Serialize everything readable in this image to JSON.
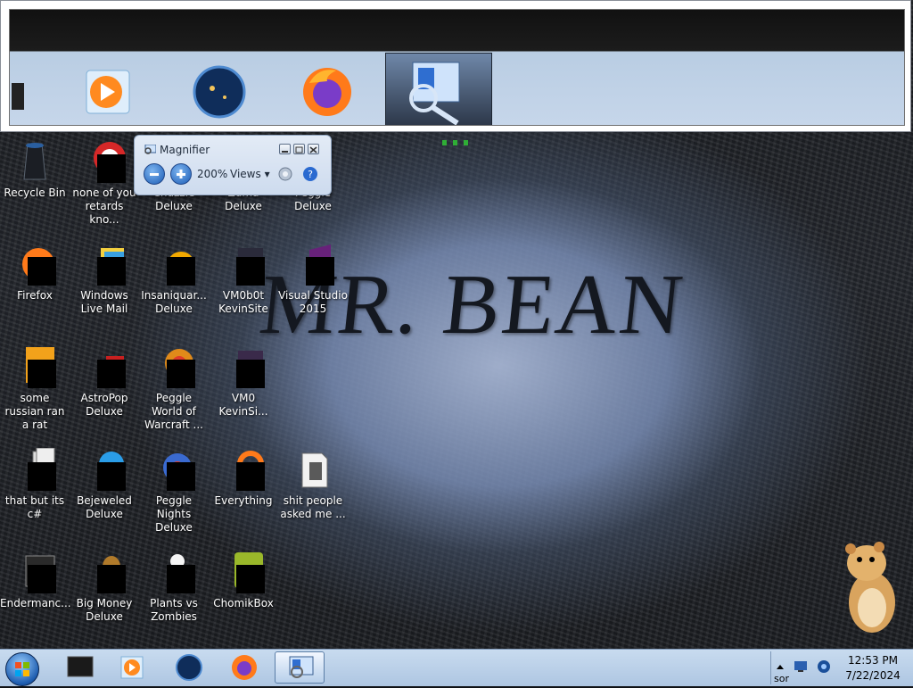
{
  "wallpaper": {
    "text": "MR. BEAN"
  },
  "magnifier_window": {
    "title": "Magnifier",
    "zoom_level": "200%",
    "views_label": "Views"
  },
  "desktop_icons": [
    {
      "label": "Recycle Bin",
      "icon": "recycle-bin-icon"
    },
    {
      "label": "none of you retards kno...",
      "icon": "app-icon"
    },
    {
      "label": "Chuzzle Deluxe",
      "icon": "chuzzle-icon"
    },
    {
      "label": "Zuma Deluxe",
      "icon": "zuma-icon"
    },
    {
      "label": "Peggle Deluxe",
      "icon": "peggle-icon"
    },
    {
      "label": "Firefox",
      "icon": "firefox-icon"
    },
    {
      "label": "Windows Live Mail",
      "icon": "mail-icon"
    },
    {
      "label": "Insaniquar... Deluxe",
      "icon": "insaniquarium-icon"
    },
    {
      "label": "VM0b0t KevinSite",
      "icon": "vm-icon"
    },
    {
      "label": "Visual Studio 2015",
      "icon": "visual-studio-icon"
    },
    {
      "label": "some russian ran a rat",
      "icon": "app-icon"
    },
    {
      "label": "AstroPop Deluxe",
      "icon": "astropop-icon"
    },
    {
      "label": "Peggle World of Warcraft ...",
      "icon": "peggle-icon"
    },
    {
      "label": "VM0 KevinSi...",
      "icon": "vm-icon"
    },
    {
      "label": "that but its c#",
      "icon": "file-icon"
    },
    {
      "label": "Bejeweled Deluxe",
      "icon": "bejeweled-icon"
    },
    {
      "label": "Peggle Nights Deluxe",
      "icon": "peggle-icon"
    },
    {
      "label": "Everything",
      "icon": "search-icon"
    },
    {
      "label": "shit people asked me ...",
      "icon": "folder-icon"
    },
    {
      "label": "Endermanc...",
      "icon": "app-icon"
    },
    {
      "label": "Big Money Deluxe",
      "icon": "money-bag-icon"
    },
    {
      "label": "Plants vs Zombies",
      "icon": "plants-icon"
    },
    {
      "label": "ChomikBox",
      "icon": "chomikbox-icon"
    }
  ],
  "taskbar": {
    "buttons": [
      {
        "name": "start-button",
        "icon": "windows-logo-icon"
      },
      {
        "name": "taskbar-app-1",
        "icon": "monitor-icon"
      },
      {
        "name": "taskbar-media-player",
        "icon": "media-player-icon"
      },
      {
        "name": "taskbar-globe",
        "icon": "globe-icon"
      },
      {
        "name": "taskbar-firefox",
        "icon": "firefox-icon"
      },
      {
        "name": "taskbar-magnifier",
        "icon": "magnifier-icon"
      }
    ],
    "tray_text": "sor",
    "clock_time": "12:53 PM",
    "clock_date": "7/22/2024"
  },
  "colors": {
    "taskbar": "#b7cde6",
    "magnifier_window": "#d7e2f1",
    "firefox_orange": "#ff7a1a"
  }
}
